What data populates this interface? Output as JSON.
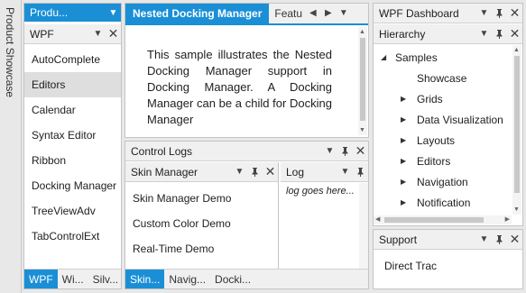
{
  "side_strip": {
    "label": "Product Showcase"
  },
  "left_pane": {
    "header_title": "Produ...",
    "wpf_header": "WPF",
    "items": [
      {
        "label": "AutoComplete"
      },
      {
        "label": "Editors"
      },
      {
        "label": "Calendar"
      },
      {
        "label": "Syntax Editor"
      },
      {
        "label": "Ribbon"
      },
      {
        "label": "Docking Manager"
      },
      {
        "label": "TreeViewAdv"
      },
      {
        "label": "TabControlExt"
      }
    ],
    "selected_index": 1,
    "tabs": [
      {
        "label": "WPF"
      },
      {
        "label": "Wi..."
      },
      {
        "label": "Silv..."
      }
    ]
  },
  "document": {
    "tabs": [
      {
        "label": "Nested Docking Manager"
      },
      {
        "label": "Featu"
      }
    ],
    "body_text": "This sample illustrates the Nested Docking Manager support in Docking Manager. A Docking Manager can be a child for Docking Manager"
  },
  "control_logs": {
    "title": "Control Logs",
    "skin_manager": {
      "title": "Skin Manager",
      "items": [
        {
          "label": "Skin Manager Demo"
        },
        {
          "label": "Custom Color Demo"
        },
        {
          "label": "Real-Time Demo"
        }
      ]
    },
    "log": {
      "title": "Log",
      "text": "log goes here..."
    },
    "tabs": [
      {
        "label": "Skin..."
      },
      {
        "label": "Navig..."
      },
      {
        "label": "Docki..."
      }
    ]
  },
  "right_pane": {
    "dashboard_title": "WPF Dashboard",
    "hierarchy_title": "Hierarchy",
    "tree": {
      "root": "Samples",
      "children": [
        {
          "label": "Showcase",
          "expandable": false
        },
        {
          "label": "Grids",
          "expandable": true
        },
        {
          "label": "Data Visualization",
          "expandable": true
        },
        {
          "label": "Layouts",
          "expandable": true
        },
        {
          "label": "Editors",
          "expandable": true
        },
        {
          "label": "Navigation",
          "expandable": true
        },
        {
          "label": "Notification",
          "expandable": true
        }
      ]
    },
    "support": {
      "title": "Support",
      "items": [
        {
          "label": "Direct Trac"
        }
      ]
    }
  },
  "colors": {
    "accent": "#1a8fd6",
    "selected_item": "#dedede"
  }
}
